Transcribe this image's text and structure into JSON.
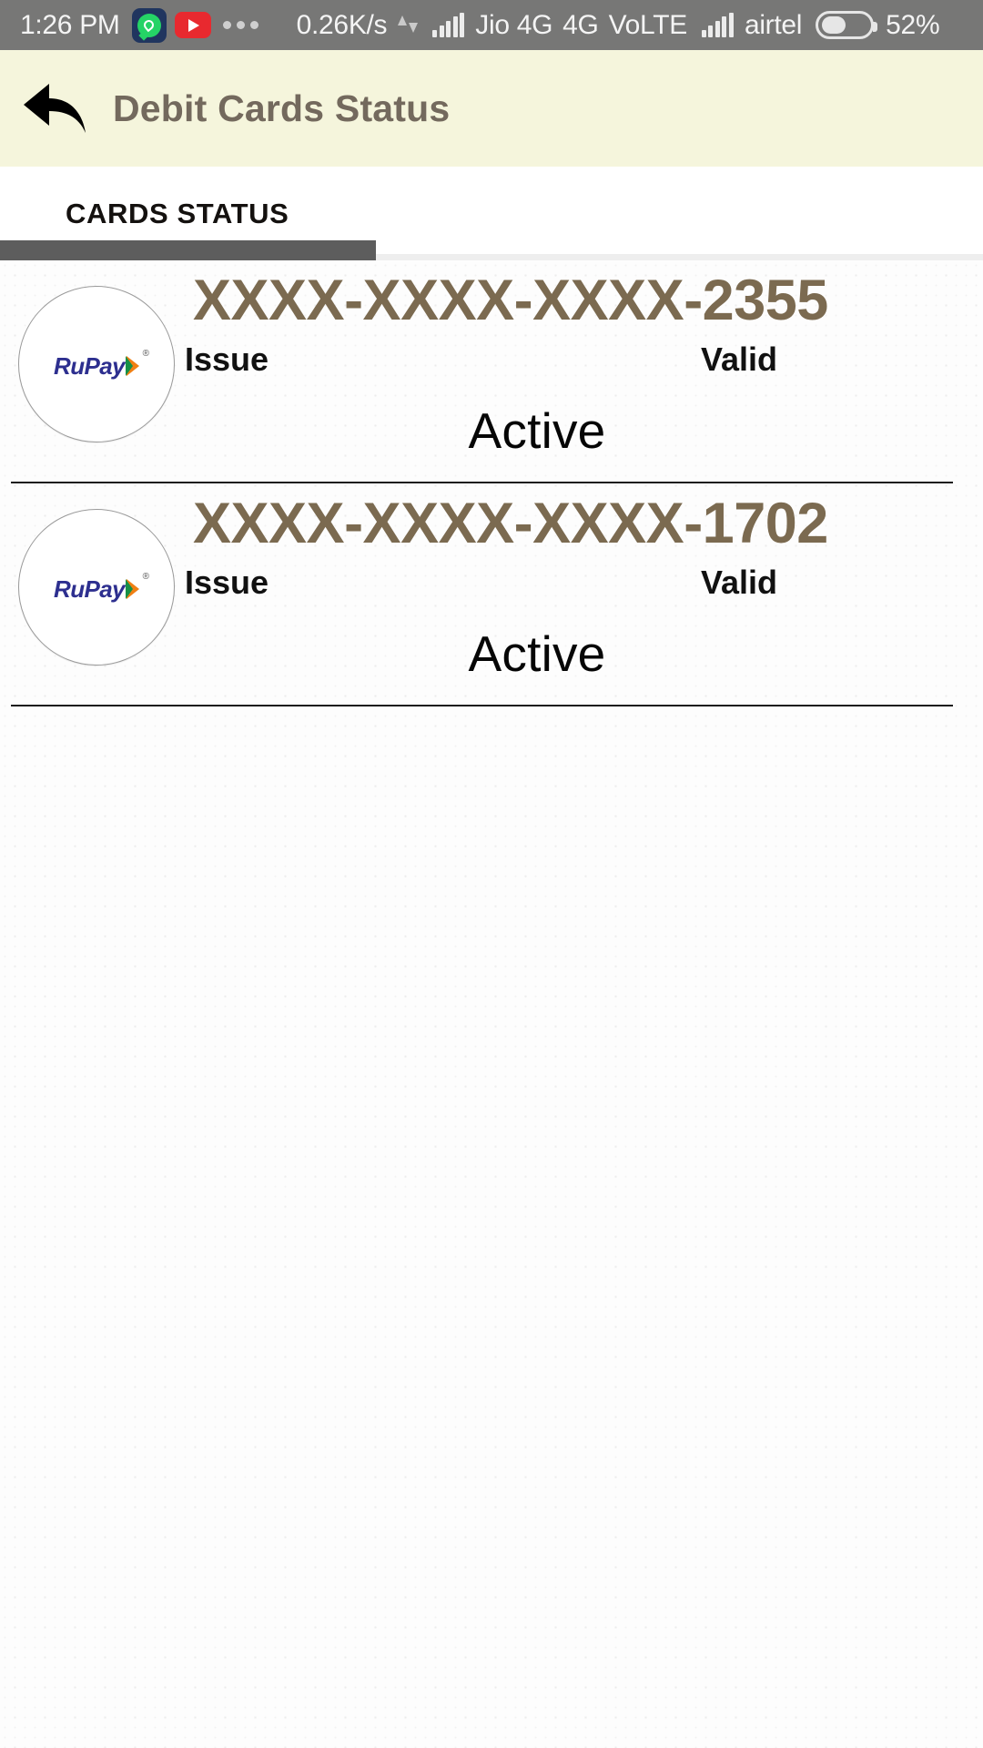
{
  "status_bar": {
    "clock": "1:26 PM",
    "icons": [
      "whatsapp-icon",
      "youtube-icon",
      "more-dots-icon"
    ],
    "network_speed": "0.26K/s",
    "data_arrows": "up-down-arrows-icon",
    "signal_1": "signal-bars-icon",
    "carrier_1": "Jio 4G",
    "network_type": "4G",
    "volte": "VoLTE",
    "signal_2": "signal-bars-icon",
    "carrier_2": "airtel",
    "battery_icon": "battery-icon",
    "battery_percent": "52%",
    "background_color": "#777776",
    "text_color": "#f4f4f4"
  },
  "app_bar": {
    "back_icon": "back-arrow-icon",
    "title": "Debit Cards Status",
    "background_color": "#f5f5dc",
    "title_color": "#73695d"
  },
  "tabs": {
    "items": [
      {
        "label": "CARDS STATUS",
        "selected": true
      }
    ],
    "indicator_color": "#5d5d5d",
    "track_color": "#eeeeee"
  },
  "cards": [
    {
      "brand_logo": "rupay-logo",
      "brand_text": "RuPay",
      "number": "XXXX-XXXX-XXXX-2355",
      "issue_label": "Issue",
      "issue_value": "",
      "valid_label": "Valid",
      "valid_value": "",
      "status": "Active"
    },
    {
      "brand_logo": "rupay-logo",
      "brand_text": "RuPay",
      "number": "XXXX-XXXX-XXXX-1702",
      "issue_label": "Issue",
      "issue_value": "",
      "valid_label": "Valid",
      "valid_value": "",
      "status": "Active"
    }
  ],
  "colors": {
    "card_number": "#7b6a50",
    "status_text": "#060606",
    "divider": "#1a1a1a",
    "page_background": "#fdfdfd"
  }
}
